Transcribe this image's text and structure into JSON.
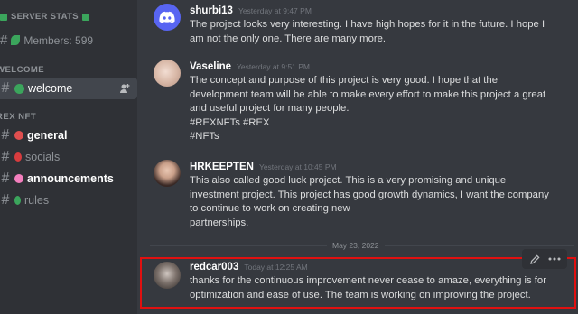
{
  "sidebar": {
    "stats_title": "SERVER STATS",
    "members": "Members: 599",
    "categories": [
      {
        "name": "WELCOME"
      },
      {
        "name": "REX NFT"
      }
    ],
    "channels": {
      "welcome": "welcome",
      "general": "general",
      "socials": "socials",
      "announcements": "announcements",
      "rules": "rules"
    }
  },
  "messages": [
    {
      "author": "shurbi13",
      "time": "Yesterday at 9:47 PM",
      "lines": [
        "The project looks very interesting. I have high hopes for it in the future. I hope I",
        "am not the only one. There are many more."
      ]
    },
    {
      "author": "Vaseline",
      "time": "Yesterday at 9:51 PM",
      "lines": [
        "The concept and purpose of this project is very good. I hope that the",
        "development team will be able to make every effort to make this project a great",
        "and useful project for many people.",
        "#REXNFTs #REX",
        "#NFTs"
      ]
    },
    {
      "author": "HRKEEPTEN",
      "time": "Yesterday at 10:45 PM",
      "lines": [
        "This also called good luck project. This  is a very promising and unique",
        "investment project. This project has good growth dynamics, I want the company",
        "to continue to work on creating new",
        "partnerships."
      ]
    },
    {
      "author": "redcar003",
      "time": "Today at 12:25 AM",
      "lines": [
        "thanks for the continuous improvement never cease to amaze, everything is for",
        "optimization and ease of use. The team is working on improving the project."
      ]
    }
  ],
  "date_divider": "May 23, 2022",
  "colors": {
    "highlight": "#e01010",
    "discord_blurple": "#5865f2"
  },
  "icons": {
    "stats": "chart-icon",
    "members": "leaf-icon",
    "add_member": "add-member-icon",
    "edit": "pencil-icon",
    "more": "more-icon"
  }
}
